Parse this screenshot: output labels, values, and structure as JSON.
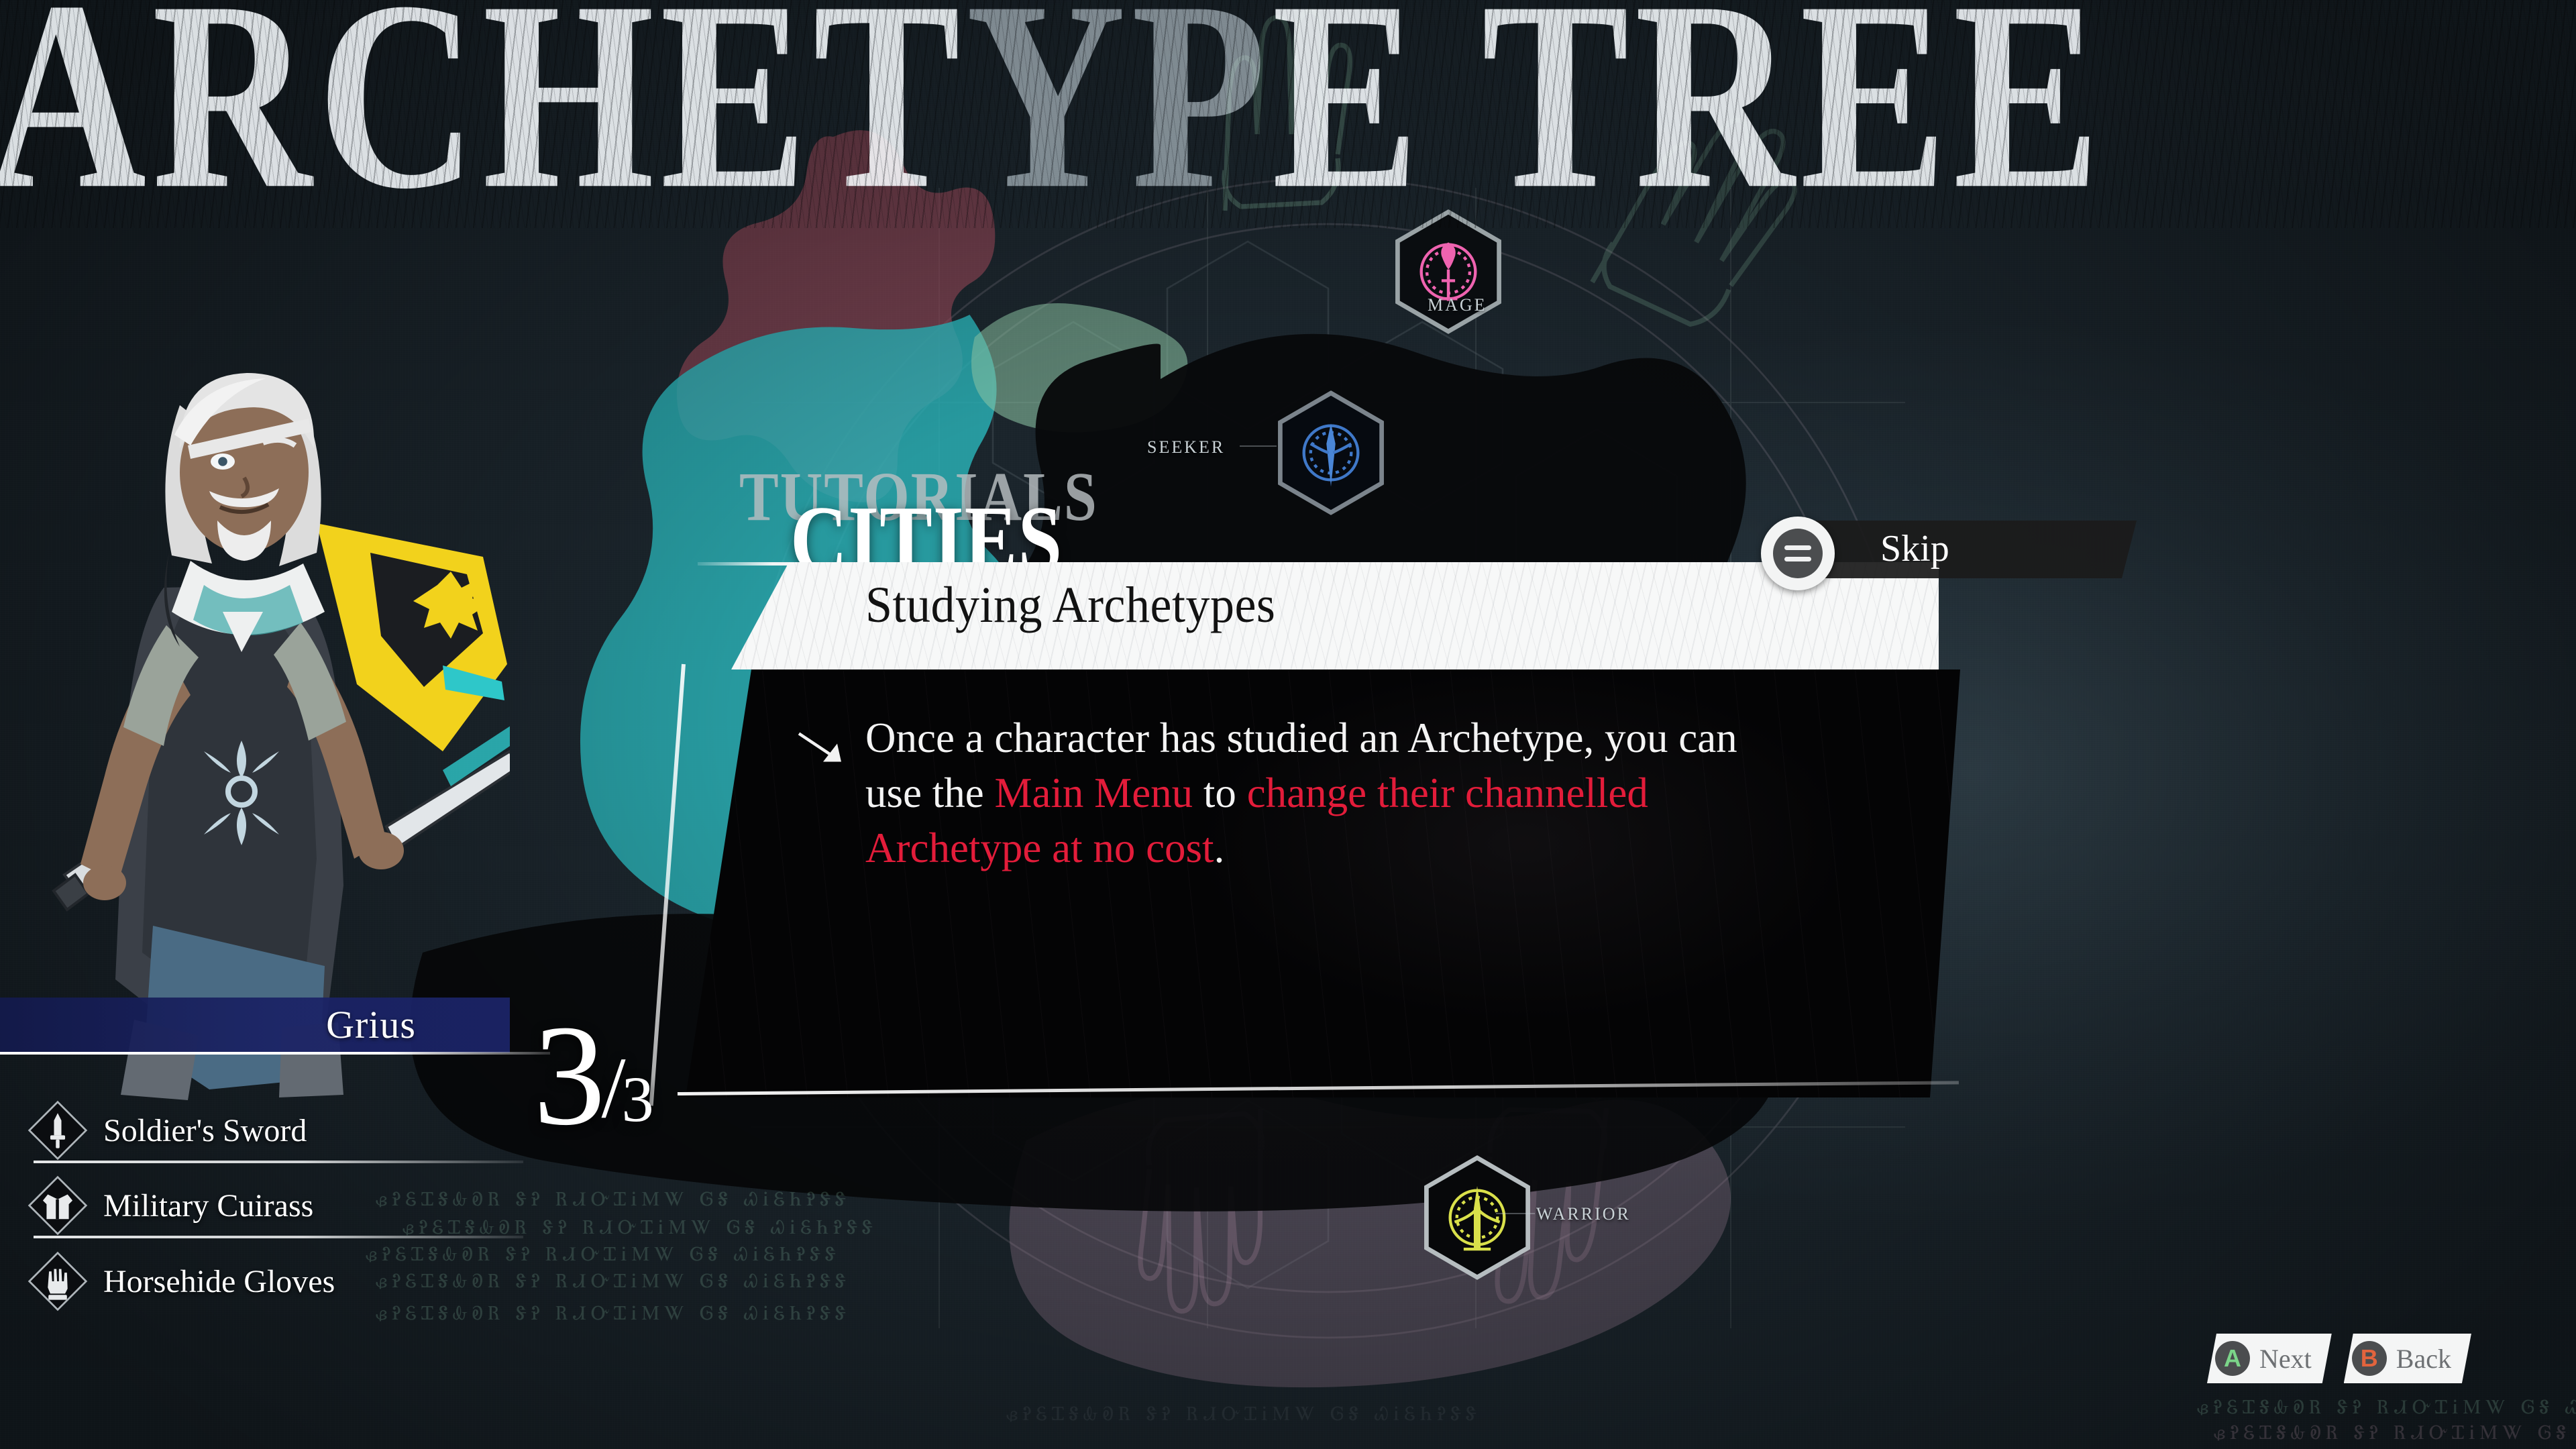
{
  "page_title": "ARCHETYPE TREE",
  "page_title_parts": {
    "bright": "ARCHET",
    "dim": "YP",
    "bright2": "E TREE"
  },
  "tutorial": {
    "kicker_top": "TUTORIALS",
    "kicker_main": "CITIES",
    "heading": "Studying Archetypes",
    "body_segments": [
      {
        "text": "Once a character has studied an Archetype, you can use the ",
        "style": "normal"
      },
      {
        "text": "Main Menu",
        "style": "highlight"
      },
      {
        "text": " to ",
        "style": "normal"
      },
      {
        "text": "change their channelled Archetype at no cost",
        "style": "highlight"
      },
      {
        "text": ".",
        "style": "normal"
      }
    ],
    "body_plain": "Once a character has studied an Archetype, you can use the Main Menu to change their channelled Archetype at no cost.",
    "page_current": "3",
    "page_separator": "/",
    "page_total": "3",
    "highlight_color": "#e31c3a"
  },
  "skip_button": {
    "label": "Skip",
    "icon": "menu-icon"
  },
  "character": {
    "name": "Grius",
    "name_bar_color": "#1a2265",
    "items": [
      {
        "label": "Soldier's Sword",
        "icon": "sword-icon"
      },
      {
        "label": "Military Cuirass",
        "icon": "chest-armor-icon"
      },
      {
        "label": "Horsehide Gloves",
        "icon": "glove-icon"
      }
    ]
  },
  "prompts": [
    {
      "button": "A",
      "label": "Next",
      "color": "#7bd489"
    },
    {
      "button": "B",
      "label": "Back",
      "color": "#e2643d"
    }
  ],
  "archetype_nodes": [
    {
      "label": "MAGE",
      "color": "#ef63b0"
    },
    {
      "label": "SEEKER",
      "color": "#3f78c8"
    },
    {
      "label": "WARRIOR",
      "color": "#d9e04a"
    }
  ],
  "decor": {
    "rune_line": "ᏸᎮᏋᏆᎦᎲᎧᏒ ᏕᎮ ᏒᏗᏅᏆᎥᎷᏔ ᎶᎦ ᏇᎥᏋᏂᎮᏕᏕ",
    "splat_teal": "#2ab3b8",
    "splat_rose": "#9c4a5b",
    "splat_green": "#8fc9a8",
    "splat_pink": "#caa0bc"
  }
}
